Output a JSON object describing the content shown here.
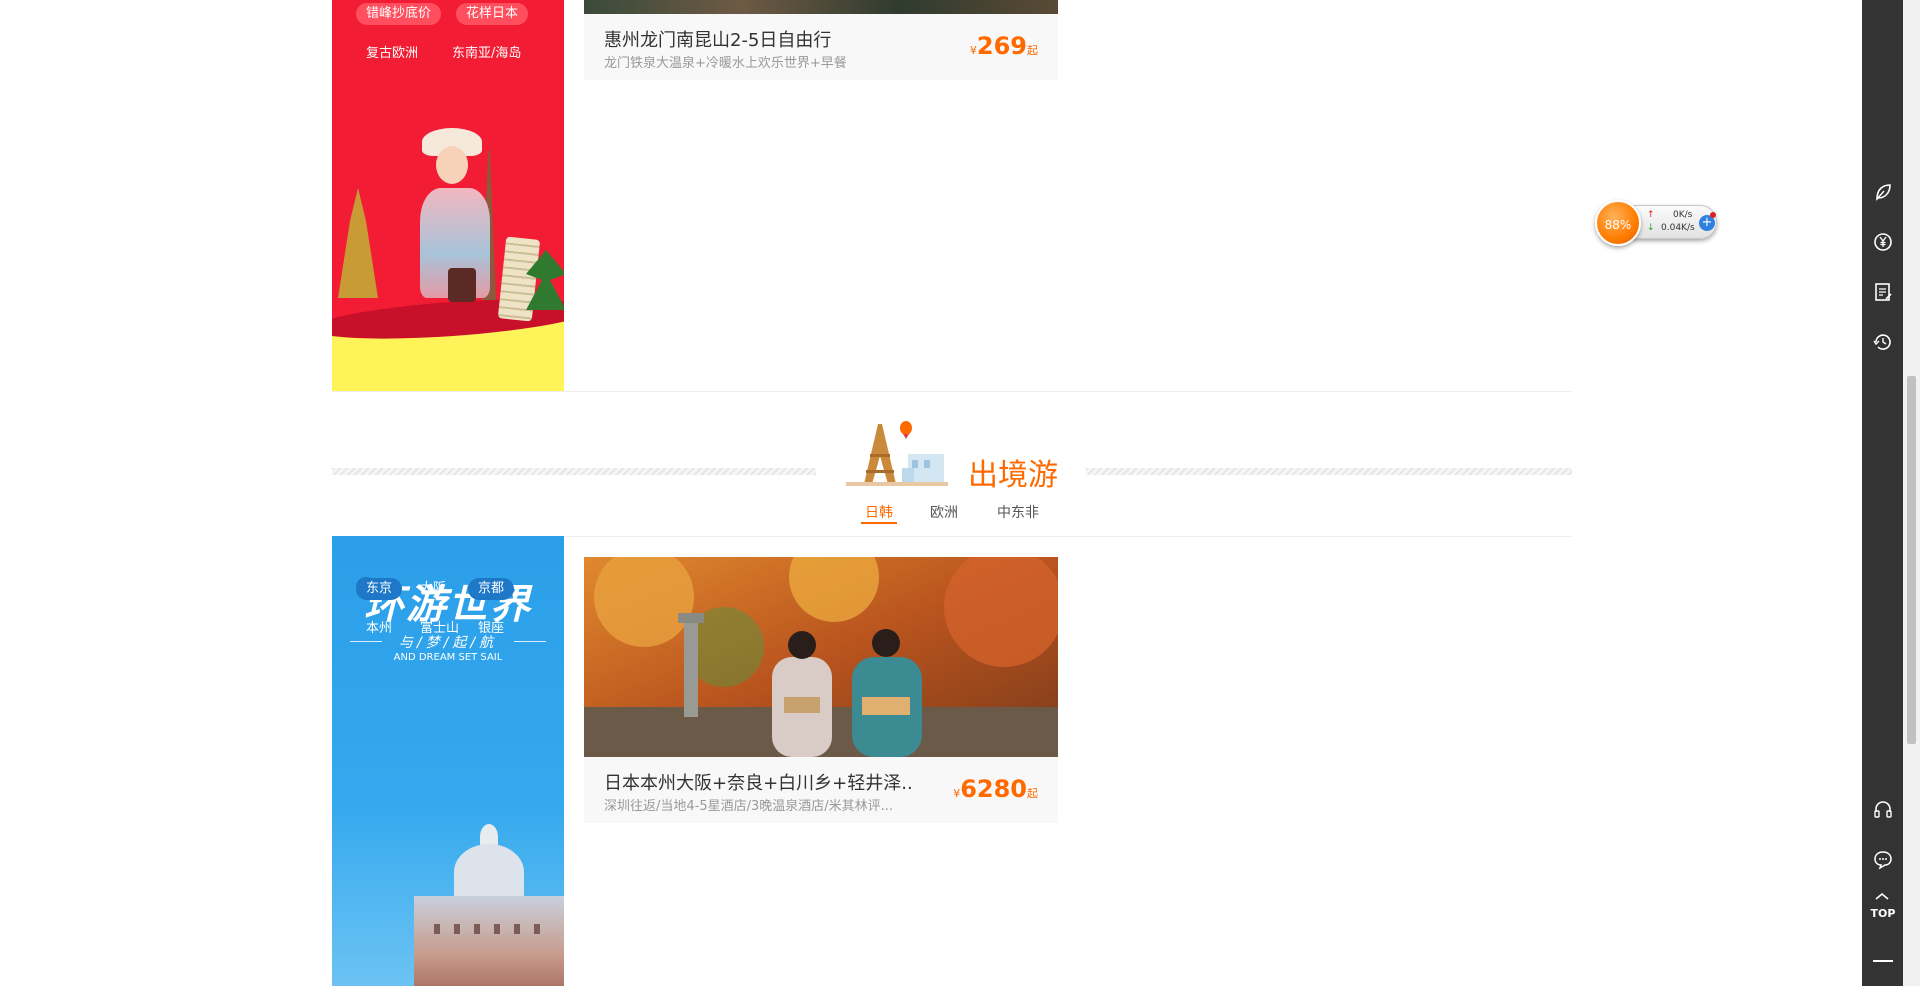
{
  "top_section": {
    "banner": {
      "tags_row1": [
        "错峰抄底价",
        "花样日本"
      ],
      "tags_row2": [
        "复古欧洲",
        "东南亚/海岛"
      ]
    },
    "card": {
      "title": "惠州龙门南昆山2-5日自由行",
      "subtitle": "龙门铁泉大温泉+冷暖水上欢乐世界+早餐",
      "currency": "¥",
      "price": "269",
      "suffix": "起"
    }
  },
  "outbound_section": {
    "title": "出境游",
    "tabs": [
      "日韩",
      "欧洲",
      "中东非"
    ],
    "active_tab": "日韩",
    "banner": {
      "headline": "环游世界",
      "subline": "与/梦/起/航",
      "english": "AND DREAM SET SAIL",
      "tags_row1": [
        "东京",
        "大阪",
        "京都"
      ],
      "tags_row2": [
        "本州",
        "富士山",
        "银座"
      ]
    },
    "card": {
      "title": "日本本州大阪+奈良+白川乡+轻井泽...",
      "subtitle": "深圳往返/当地4-5星酒店/3晚温泉酒店/米其林评...",
      "currency": "¥",
      "price": "6280",
      "suffix": "起"
    }
  },
  "sidebar": {
    "top_label": "TOP"
  },
  "speed_widget": {
    "percent": "88%",
    "upload": "0K/s",
    "download": "0.04K/s"
  },
  "colors": {
    "accent": "#ff6a00",
    "red_banner": "#f21d34",
    "blue_banner": "#2a9ee8",
    "sidebar": "#333333"
  }
}
